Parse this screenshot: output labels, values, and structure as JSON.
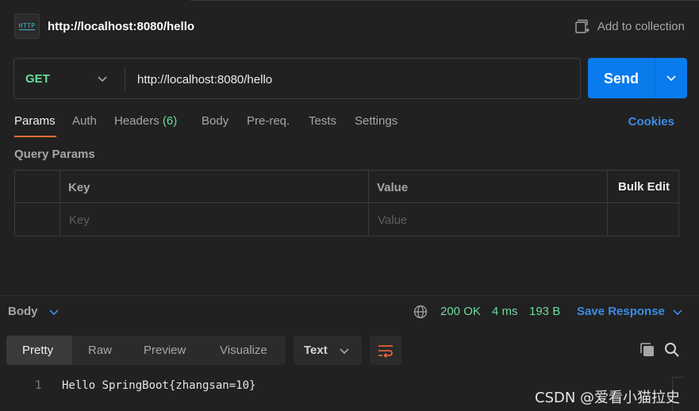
{
  "header": {
    "icon_text": "HTTP",
    "title": "http://localhost:8080/hello",
    "add_collection": "Add to collection"
  },
  "request": {
    "method": "GET",
    "url": "http://localhost:8080/hello",
    "send_label": "Send"
  },
  "tabs": {
    "params": "Params",
    "auth": "Auth",
    "headers": "Headers",
    "headers_count": "(6)",
    "body": "Body",
    "prereq": "Pre-req.",
    "tests": "Tests",
    "settings": "Settings",
    "cookies": "Cookies"
  },
  "query_params": {
    "title": "Query Params",
    "col_key": "Key",
    "col_value": "Value",
    "bulk_edit": "Bulk Edit",
    "key_placeholder": "Key",
    "value_placeholder": "Value"
  },
  "response": {
    "body_label": "Body",
    "status": "200 OK",
    "time": "4 ms",
    "size": "193 B",
    "save_response": "Save Response",
    "views": [
      "Pretty",
      "Raw",
      "Preview",
      "Visualize"
    ],
    "format": "Text",
    "lines": [
      {
        "no": "1",
        "text": "Hello SpringBoot{zhangsan=10}"
      }
    ]
  },
  "watermark": "CSDN @爱看小猫拉史",
  "colors": {
    "background": "#212121",
    "accent_orange": "#ff6c37",
    "send_blue": "#097bed",
    "link_blue": "#3c8ce7",
    "success_green": "#6bdd9a"
  }
}
